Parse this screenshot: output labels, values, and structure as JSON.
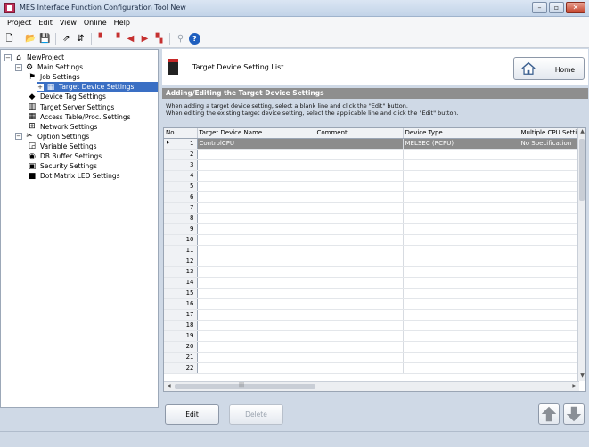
{
  "window": {
    "title": "MES Interface Function Configuration Tool New",
    "buttons": [
      "–",
      "▫",
      "✕"
    ]
  },
  "menu": [
    {
      "label": "Project"
    },
    {
      "label": "Edit"
    },
    {
      "label": "View"
    },
    {
      "label": "Online"
    },
    {
      "label": "Help"
    }
  ],
  "toolbar": [
    {
      "icon": "new-project-icon",
      "glyph": "🗋"
    },
    {
      "icon": "open-project-icon",
      "glyph": "📂"
    },
    {
      "icon": "save-icon",
      "glyph": "💾"
    },
    {
      "icon": "write-icon",
      "glyph": "⇗"
    },
    {
      "icon": "verify-icon",
      "glyph": "⇵"
    },
    {
      "icon": "device-read-icon",
      "glyph": "▘"
    },
    {
      "icon": "device-write-icon",
      "glyph": "▝"
    },
    {
      "icon": "device-compare-icon",
      "glyph": "◀"
    },
    {
      "icon": "device-transfer-icon",
      "glyph": "▶"
    },
    {
      "icon": "device-diagnose-icon",
      "glyph": "▚"
    },
    {
      "icon": "search-icon",
      "glyph": "⚲"
    },
    {
      "icon": "help-icon",
      "glyph": "?"
    }
  ],
  "tree": [
    {
      "label": "NewProject",
      "icon": "home-icon",
      "glyph": "⌂",
      "expander": "−",
      "level": 0
    },
    {
      "label": "Main Settings",
      "icon": "gear-icon",
      "glyph": "⚙",
      "expander": "−",
      "level": 1
    },
    {
      "label": "Job Settings",
      "icon": "job-icon",
      "glyph": "⚑",
      "level": 2
    },
    {
      "label": "Target Device Settings",
      "icon": "target-device-icon",
      "glyph": "▦",
      "expander": "+",
      "level": 2,
      "selected": true
    },
    {
      "label": "Device Tag Settings",
      "icon": "tag-icon",
      "glyph": "◆",
      "level": 2
    },
    {
      "label": "Target Server Settings",
      "icon": "server-icon",
      "glyph": "▥",
      "level": 2
    },
    {
      "label": "Access Table/Proc. Settings",
      "icon": "table-icon",
      "glyph": "▦",
      "level": 2
    },
    {
      "label": "Network Settings",
      "icon": "network-icon",
      "glyph": "⊞",
      "level": 2
    },
    {
      "label": "Option Settings",
      "icon": "tools-icon",
      "glyph": "✂",
      "expander": "−",
      "level": 1
    },
    {
      "label": "Variable Settings",
      "icon": "variable-icon",
      "glyph": "◲",
      "level": 2
    },
    {
      "label": "DB Buffer Settings",
      "icon": "database-icon",
      "glyph": "◉",
      "level": 2
    },
    {
      "label": "Security Settings",
      "icon": "security-icon",
      "glyph": "▣",
      "level": 2
    },
    {
      "label": "Dot Matrix LED Settings",
      "icon": "led-icon",
      "glyph": "■",
      "level": 2
    }
  ],
  "header": {
    "title": "Target Device Setting List",
    "home_label": "Home"
  },
  "section": {
    "title": "Adding/Editing the Target Device Settings",
    "line1": "When adding a target device setting, select a blank line and click the \"Edit\" button.",
    "line2": "When editing the existing target device setting, select the applicable line and click the \"Edit\" button."
  },
  "table": {
    "columns": [
      "No.",
      "Target Device Name",
      "Comment",
      "Device Type",
      "Multiple CPU Setti"
    ],
    "rows": [
      [
        "1",
        "ControlCPU",
        "",
        "MELSEC (RCPU)",
        "No Specification"
      ],
      [
        "2",
        "",
        "",
        "",
        ""
      ],
      [
        "3",
        "",
        "",
        "",
        ""
      ],
      [
        "4",
        "",
        "",
        "",
        ""
      ],
      [
        "5",
        "",
        "",
        "",
        ""
      ],
      [
        "6",
        "",
        "",
        "",
        ""
      ],
      [
        "7",
        "",
        "",
        "",
        ""
      ],
      [
        "8",
        "",
        "",
        "",
        ""
      ],
      [
        "9",
        "",
        "",
        "",
        ""
      ],
      [
        "10",
        "",
        "",
        "",
        ""
      ],
      [
        "11",
        "",
        "",
        "",
        ""
      ],
      [
        "12",
        "",
        "",
        "",
        ""
      ],
      [
        "13",
        "",
        "",
        "",
        ""
      ],
      [
        "14",
        "",
        "",
        "",
        ""
      ],
      [
        "15",
        "",
        "",
        "",
        ""
      ],
      [
        "16",
        "",
        "",
        "",
        ""
      ],
      [
        "17",
        "",
        "",
        "",
        ""
      ],
      [
        "18",
        "",
        "",
        "",
        ""
      ],
      [
        "19",
        "",
        "",
        "",
        ""
      ],
      [
        "20",
        "",
        "",
        "",
        ""
      ],
      [
        "21",
        "",
        "",
        "",
        ""
      ],
      [
        "22",
        "",
        "",
        "",
        ""
      ]
    ],
    "active_row": 0
  },
  "actions": {
    "edit": "Edit",
    "delete": "Delete"
  },
  "colors": {
    "selection": "#3a6fc4",
    "active_row": "#8c8c8c",
    "section_bar": "#8e8e8e",
    "arrow": "#8a8f96"
  }
}
